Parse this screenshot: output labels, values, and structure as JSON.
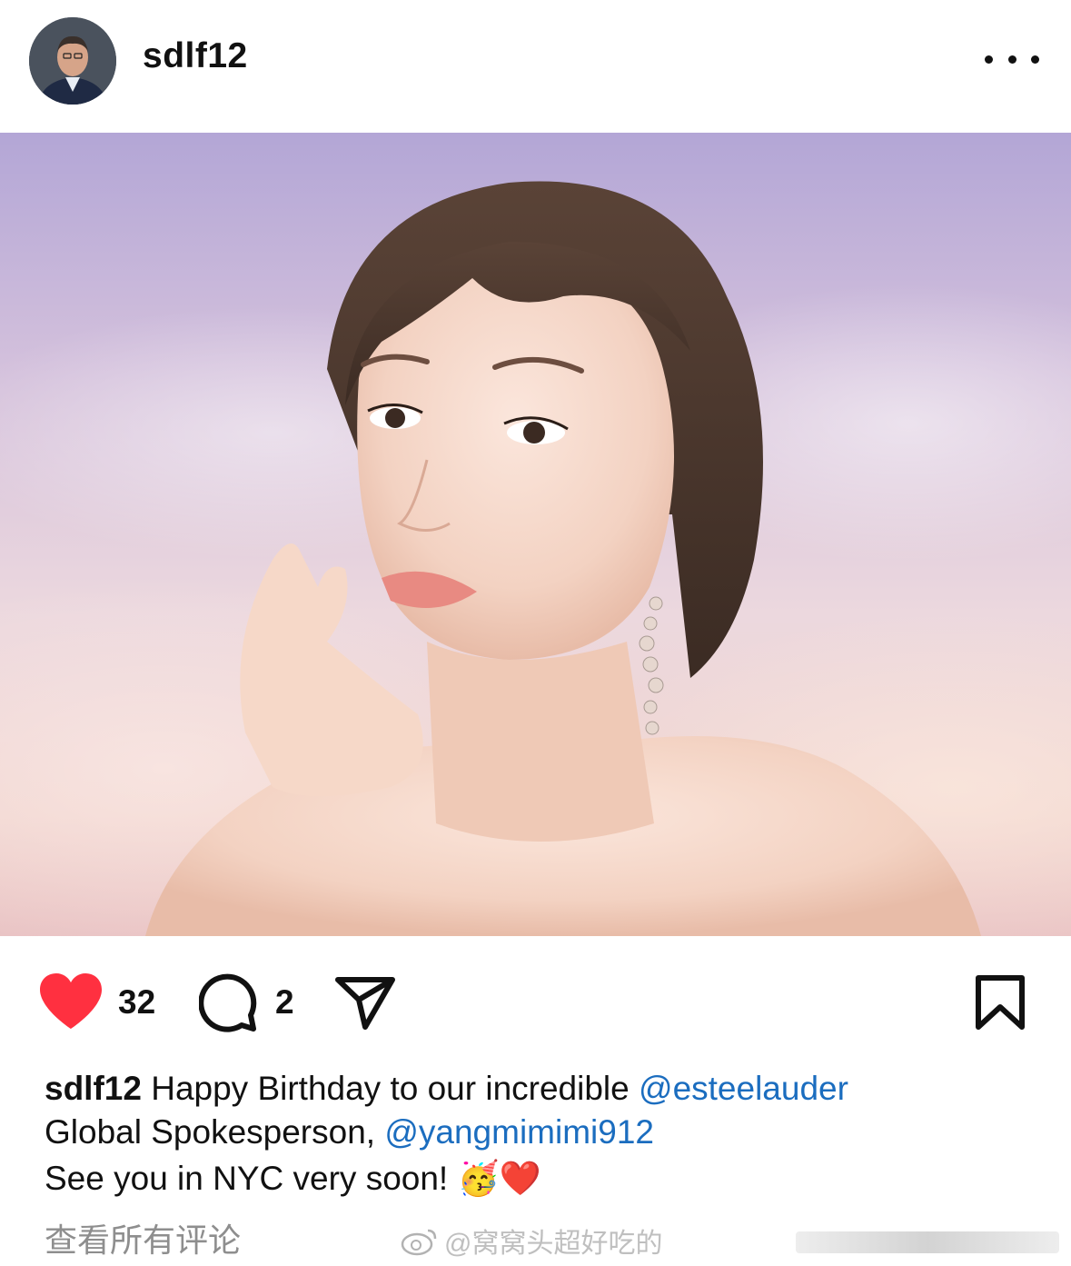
{
  "post": {
    "username": "sdlf12",
    "avatar_icon": "profile-photo-avatar",
    "more_icon": "more-options-icon",
    "photo_description_icon": "post-photo"
  },
  "actions": {
    "like_icon": "heart-icon",
    "like_count": "32",
    "like_color": "#ff3040",
    "comment_icon": "comment-icon",
    "comment_count": "2",
    "share_icon": "send-icon",
    "save_icon": "bookmark-icon"
  },
  "caption": {
    "username": "sdlf12",
    "text1": "Happy Birthday to our incredible",
    "mention1": "@esteelauder",
    "text2": "Global Spokesperson,",
    "mention2": "@yangmimimi912",
    "text3": "See you in NYC very soon!",
    "emoji1": "🥳",
    "emoji2": "❤️",
    "mention_color": "#1b6dbf"
  },
  "footer": {
    "view_all_comments": "查看所有评论",
    "watermark": "@窝窝头超好吃的"
  }
}
